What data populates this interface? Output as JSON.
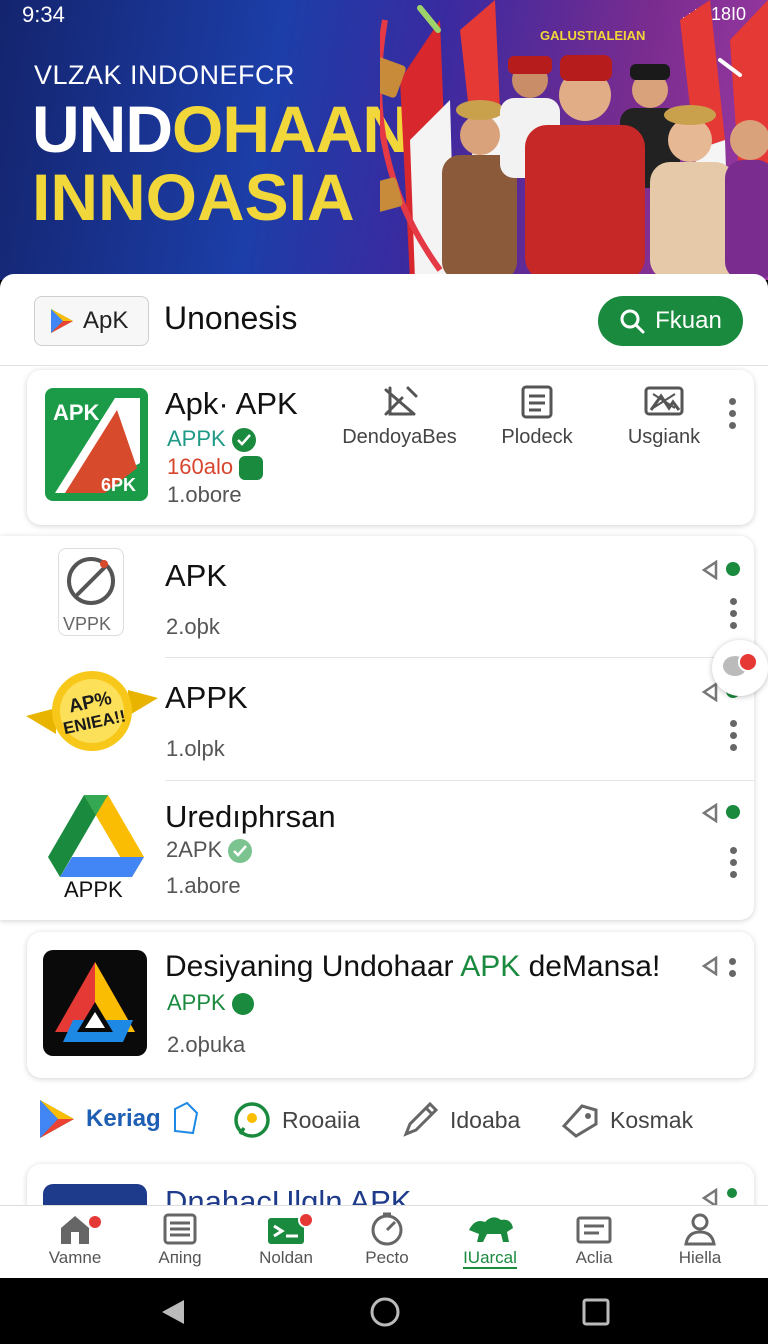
{
  "status": {
    "time": "9:34",
    "right": "¹18I0"
  },
  "banner": {
    "tagline": "VLZAK INDONEFCR",
    "title_white": "UND",
    "title_yellow": "OHAAN",
    "title_line2": "INNOASIA",
    "emblem_text": "GALUSTIALEIAN"
  },
  "topbar": {
    "chip_label": "ApK",
    "title": "Unonesis",
    "search_label": "Fkuan"
  },
  "featured": {
    "name": "Apk· APK",
    "publisher": "APPK",
    "rating": "160alo",
    "downloads": "1.obore",
    "icon_top": "APK",
    "icon_bottom": "6PK",
    "actions": [
      {
        "label": "DendoyaBes",
        "icon": "tools-icon"
      },
      {
        "label": "Plodeck",
        "icon": "document-icon"
      },
      {
        "label": "Usgiank",
        "icon": "image-icon"
      }
    ]
  },
  "list": [
    {
      "name": "APK",
      "icon_label": "VPPK",
      "meta": "2.oþk",
      "icon": "compass-icon"
    },
    {
      "name": "APPK",
      "icon_label": "AP% ENIEA!!",
      "meta": "1.olpk",
      "icon": "badge-icon"
    },
    {
      "name": "Uredıphrsan",
      "icon_label": "APPK",
      "publisher": "2APK",
      "meta": "1.abore",
      "icon": "drive-icon"
    }
  ],
  "promo": {
    "name_black": "Desiyaning Undohaar ",
    "name_green": "APK",
    "name_tail": " deMansa!",
    "publisher": "APPK",
    "meta": "2.oþuka"
  },
  "categories": [
    {
      "label": "Keriag",
      "icon": "play-store-icon"
    },
    {
      "label": "Rooaiia",
      "icon": "chat-icon"
    },
    {
      "label": "Idoaba",
      "icon": "pen-icon"
    },
    {
      "label": "Kosmak",
      "icon": "tag-icon"
    }
  ],
  "partial_item": {
    "name": "DnahacUlgln APK"
  },
  "nav": [
    {
      "label": "Vamne",
      "icon": "home-icon"
    },
    {
      "label": "Aпing",
      "icon": "list-icon"
    },
    {
      "label": "Noldan",
      "icon": "mail-icon"
    },
    {
      "label": "Pecto",
      "icon": "gauge-icon"
    },
    {
      "label": "IUarcal",
      "icon": "animal-icon"
    },
    {
      "label": "Aclia",
      "icon": "card-icon"
    },
    {
      "label": "Hiella",
      "icon": "person-icon"
    }
  ],
  "colors": {
    "accent": "#1a8a3e",
    "banner_yellow": "#f2d73b",
    "badge": "#e53935"
  }
}
